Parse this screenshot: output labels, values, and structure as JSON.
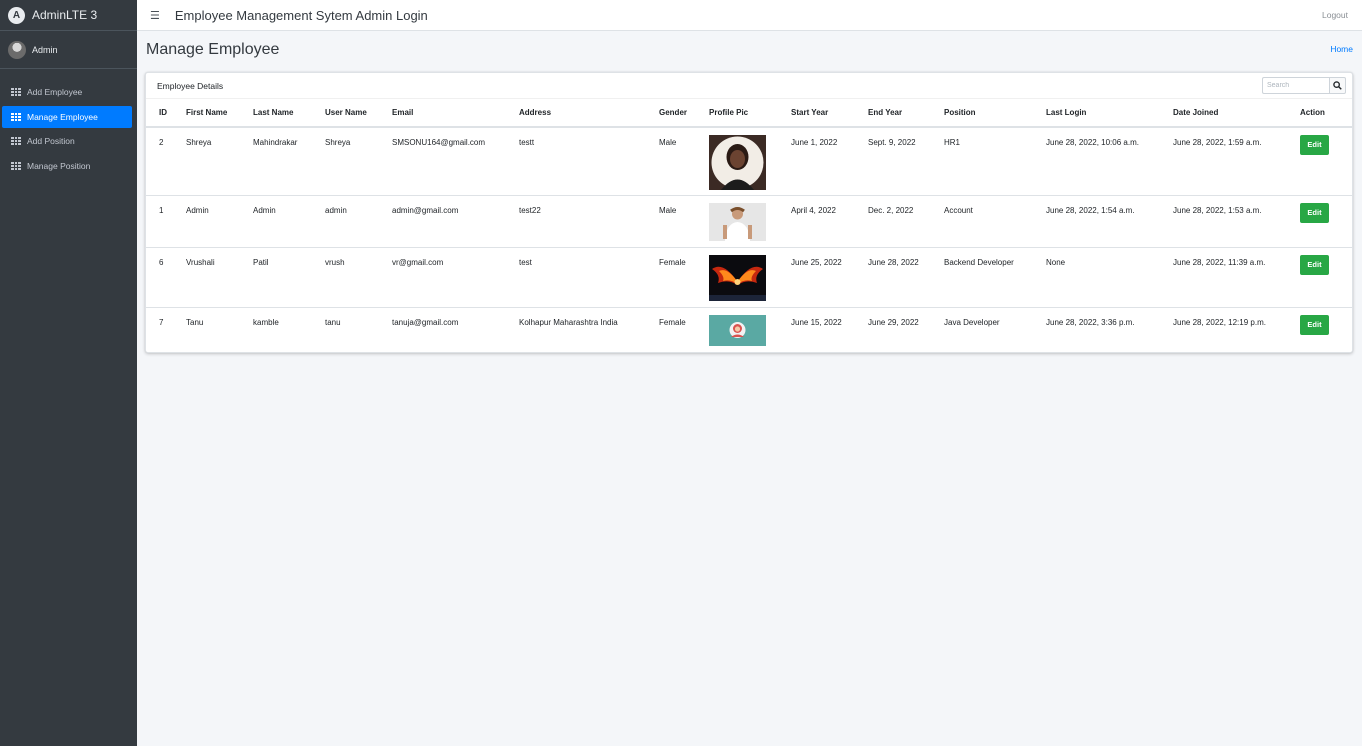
{
  "brand": {
    "name": "AdminLTE 3"
  },
  "user": {
    "name": "Admin"
  },
  "sidebar": {
    "items": [
      {
        "label": "Add Employee",
        "active": false,
        "icon": "table-icon"
      },
      {
        "label": "Manage Employee",
        "active": true,
        "icon": "table-icon"
      },
      {
        "label": "Add Position",
        "active": false,
        "icon": "table-icon"
      },
      {
        "label": "Manage Position",
        "active": false,
        "icon": "table-icon"
      }
    ]
  },
  "topbar": {
    "menu_icon": "hamburger-icon",
    "title": "Employee Management Sytem Admin Login",
    "logout_label": "Logout"
  },
  "page": {
    "title": "Manage Employee",
    "breadcrumb": "Home"
  },
  "card": {
    "title": "Employee Details",
    "search": {
      "placeholder": "Search",
      "icon": "search-icon"
    }
  },
  "table": {
    "columns": [
      "ID",
      "First Name",
      "Last Name",
      "User Name",
      "Email",
      "Address",
      "Gender",
      "Profile Pic",
      "Start Year",
      "End Year",
      "Position",
      "Last Login",
      "Date Joined",
      "Action"
    ],
    "rows": [
      {
        "id": "2",
        "first_name": "Shreya",
        "last_name": "Mahindrakar",
        "user_name": "Shreya",
        "email": "SMSONU164@gmail.com",
        "address": "testt",
        "gender": "Male",
        "pic": "woman-portrait",
        "start_year": "June 1, 2022",
        "end_year": "Sept. 9, 2022",
        "position": "HR1",
        "last_login": "June 28, 2022, 10:06 a.m.",
        "date_joined": "June 28, 2022, 1:59 a.m.",
        "action": "Edit"
      },
      {
        "id": "1",
        "first_name": "Admin",
        "last_name": "Admin",
        "user_name": "admin",
        "email": "admin@gmail.com",
        "address": "test22",
        "gender": "Male",
        "pic": "man-portrait",
        "start_year": "April 4, 2022",
        "end_year": "Dec. 2, 2022",
        "position": "Account",
        "last_login": "June 28, 2022, 1:54 a.m.",
        "date_joined": "June 28, 2022, 1:53 a.m.",
        "action": "Edit"
      },
      {
        "id": "6",
        "first_name": "Vrushali",
        "last_name": "Patil",
        "user_name": "vrush",
        "email": "vr@gmail.com",
        "address": "test",
        "gender": "Female",
        "pic": "fire-wings",
        "start_year": "June 25, 2022",
        "end_year": "June 28, 2022",
        "position": "Backend Developer",
        "last_login": "None",
        "date_joined": "June 28, 2022, 11:39 a.m.",
        "action": "Edit"
      },
      {
        "id": "7",
        "first_name": "Tanu",
        "last_name": "kamble",
        "user_name": "tanu",
        "email": "tanuja@gmail.com",
        "address": "Kolhapur Maharashtra India",
        "gender": "Female",
        "pic": "avatar-illustration",
        "start_year": "June 15, 2022",
        "end_year": "June 29, 2022",
        "position": "Java Developer",
        "last_login": "June 28, 2022, 3:36 p.m.",
        "date_joined": "June 28, 2022, 12:19 p.m.",
        "action": "Edit"
      }
    ]
  },
  "colors": {
    "sidebar_bg": "#343a40",
    "active_item": "#007bff",
    "edit_button": "#28a745",
    "content_bg": "#f4f6f9"
  }
}
